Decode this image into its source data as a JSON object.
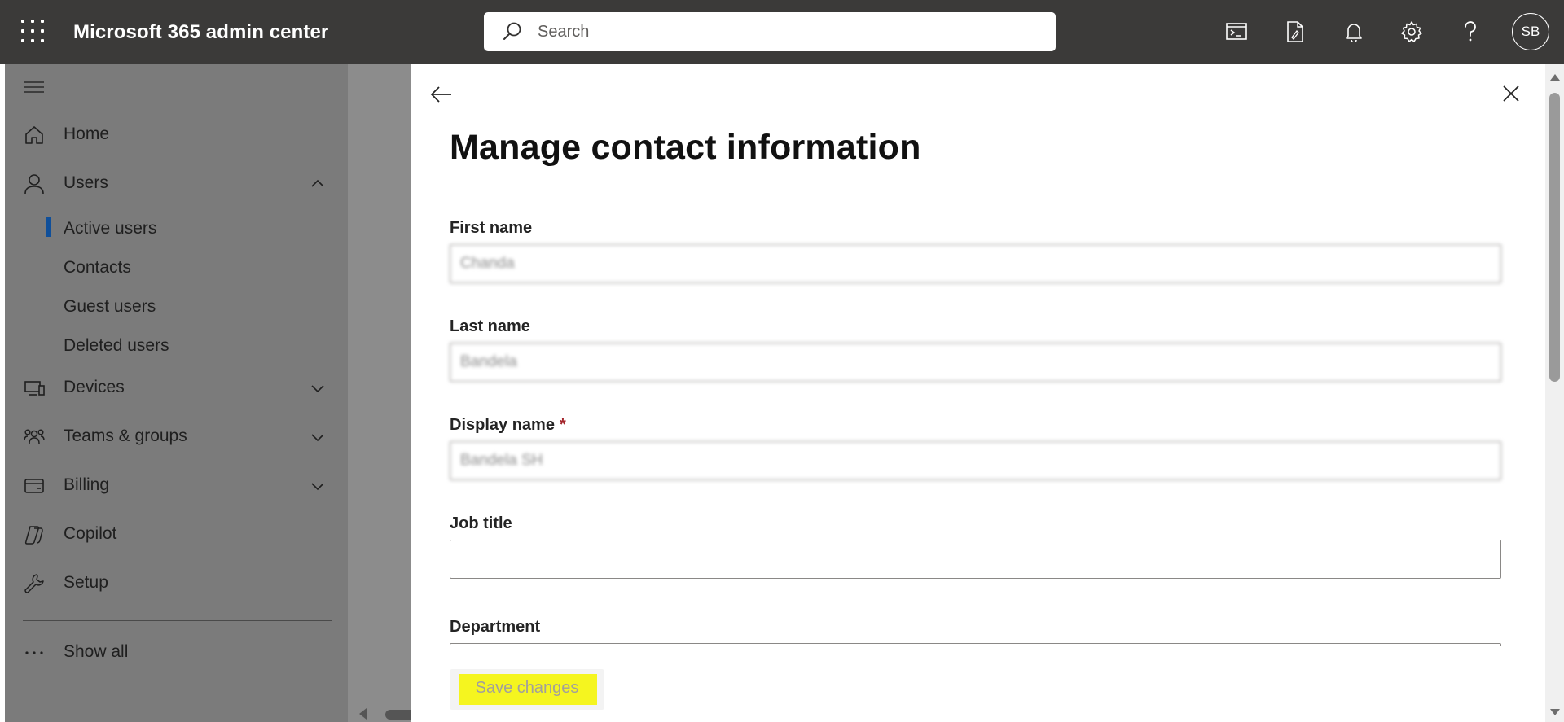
{
  "header": {
    "app_title": "Microsoft 365 admin center",
    "search_placeholder": "Search",
    "avatar_initials": "SB",
    "icons": [
      "waffle-icon",
      "search-icon",
      "terminal-icon",
      "document-sign-icon",
      "bell-icon",
      "gear-icon",
      "help-icon"
    ]
  },
  "nav": {
    "items": [
      {
        "label": "Home",
        "icon": "home-icon"
      },
      {
        "label": "Users",
        "icon": "user-icon",
        "expanded": true
      },
      {
        "label": "Devices",
        "icon": "devices-icon"
      },
      {
        "label": "Teams & groups",
        "icon": "people-team-icon"
      },
      {
        "label": "Billing",
        "icon": "billing-icon"
      },
      {
        "label": "Copilot",
        "icon": "copilot-icon"
      },
      {
        "label": "Setup",
        "icon": "wrench-icon"
      },
      {
        "label": "Show all",
        "icon": "more-icon"
      }
    ],
    "users_sub": [
      "Active users",
      "Contacts",
      "Guest users",
      "Deleted users"
    ],
    "active_sub": "Active users"
  },
  "panel": {
    "title": "Manage contact information",
    "fields": {
      "first_name": {
        "label": "First name",
        "value": "Chanda"
      },
      "last_name": {
        "label": "Last name",
        "value": "Bandela"
      },
      "display_name": {
        "label": "Display name",
        "required_mark": "*",
        "value": "Bandela SH"
      },
      "job_title": {
        "label": "Job title",
        "value": ""
      },
      "department": {
        "label": "Department",
        "value": ""
      }
    },
    "save_label": "Save changes",
    "highlight_color": "#f5f51f"
  }
}
